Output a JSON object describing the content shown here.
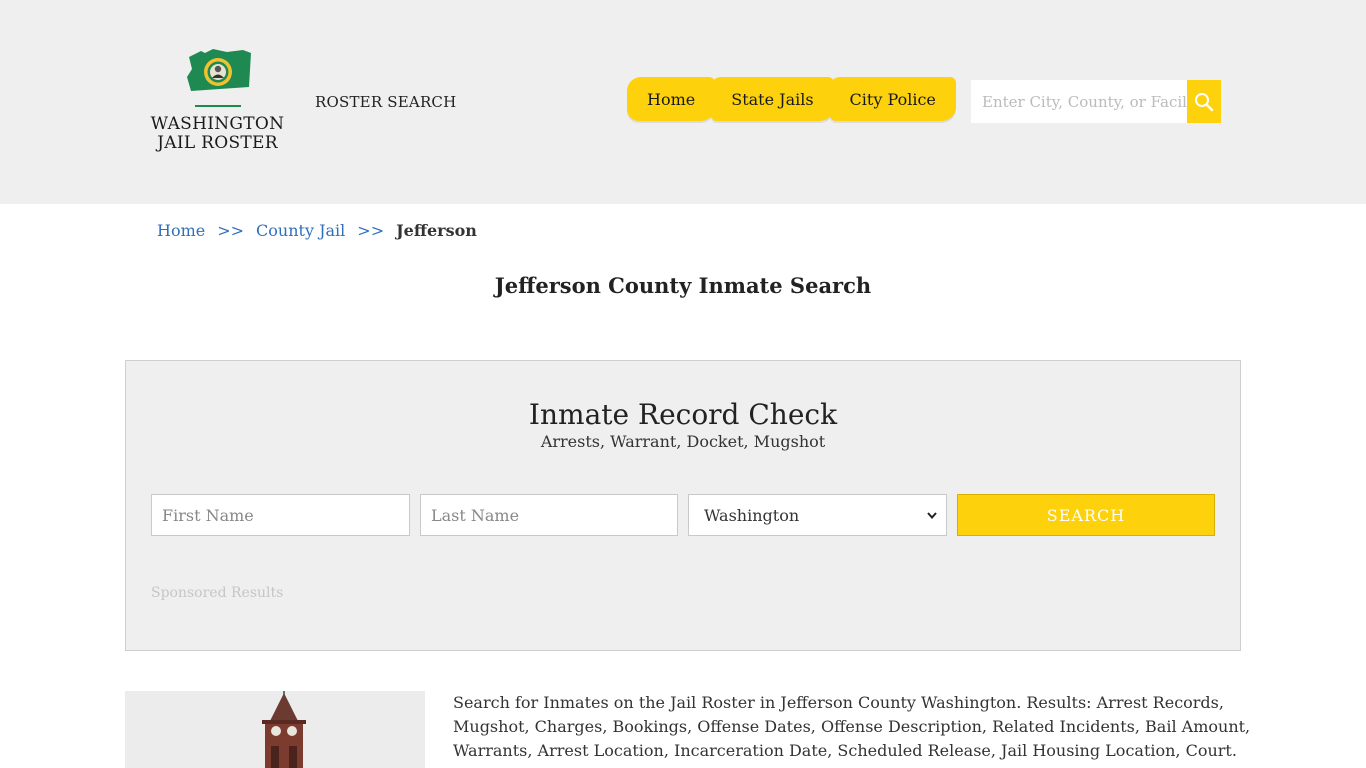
{
  "header": {
    "logo": {
      "line1": "WASHINGTON",
      "line2": "JAIL ROSTER"
    },
    "roster_search": "ROSTER SEARCH",
    "nav": [
      {
        "label": "Home"
      },
      {
        "label": "State Jails"
      },
      {
        "label": "City Police"
      }
    ],
    "search": {
      "placeholder": "Enter City, County, or Facility"
    }
  },
  "breadcrumb": {
    "home": "Home",
    "sep": ">>",
    "county_jail": "County Jail",
    "current": "Jefferson"
  },
  "page_title": "Jefferson County Inmate Search",
  "record_check": {
    "title": "Inmate Record Check",
    "subtitle": "Arrests, Warrant, Docket, Mugshot",
    "first_name_placeholder": "First Name",
    "last_name_placeholder": "Last Name",
    "state_value": "Washington",
    "search_label": "SEARCH",
    "sponsored": "Sponsored Results"
  },
  "description": "Search for Inmates on the Jail Roster in Jefferson County Washington. Results: Arrest Records, Mugshot, Charges, Bookings, Offense Dates, Offense Description, Related Incidents, Bail Amount, Warrants, Arrest Location, Incarceration Date, Scheduled Release, Jail Housing Location, Court.",
  "colors": {
    "accent": "#fdd10c",
    "header_bg": "#efefef",
    "link": "#2f6fbd",
    "flag_green": "#1e8a52"
  },
  "icons": {
    "search_button": "magnifier-icon",
    "select_arrow": "chevron-down-icon",
    "logo_flag": "washington-flag-icon"
  }
}
